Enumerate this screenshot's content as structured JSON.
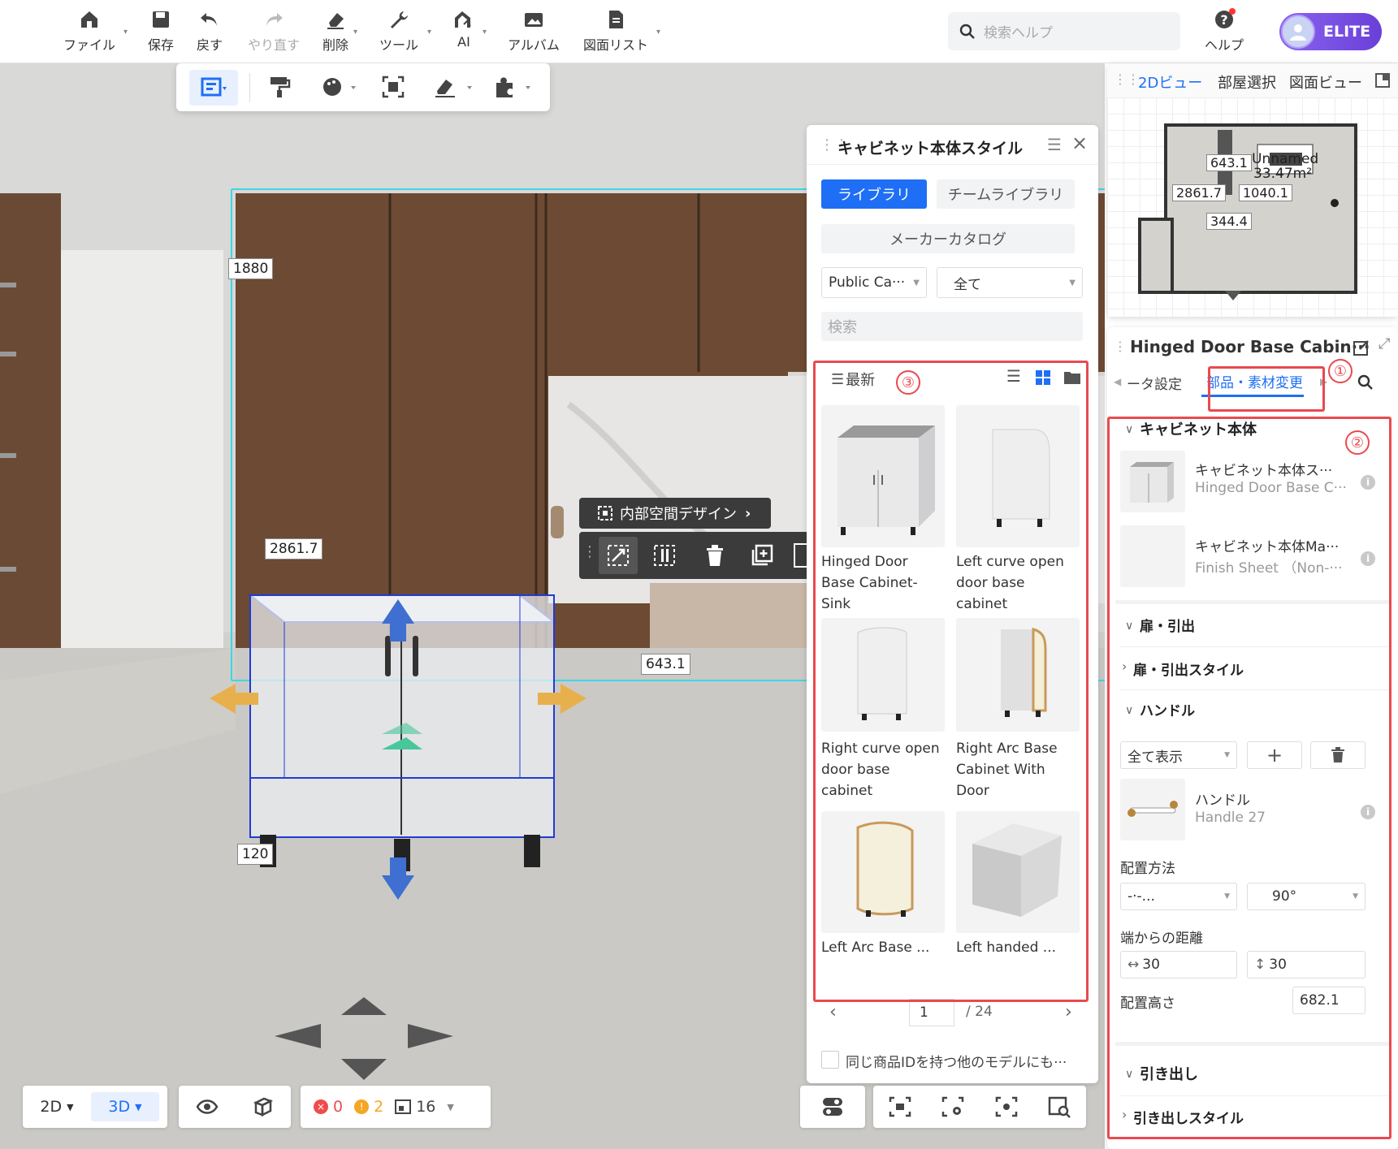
{
  "topbar": {
    "items": [
      {
        "label": "ファイル",
        "icon": "home-icon"
      },
      {
        "label": "保存",
        "icon": "save-icon"
      },
      {
        "label": "戻す",
        "icon": "undo-icon"
      },
      {
        "label": "やり直す",
        "icon": "redo-icon"
      },
      {
        "label": "削除",
        "icon": "eraser-icon"
      },
      {
        "label": "ツール",
        "icon": "wrench-icon"
      },
      {
        "label": "AI",
        "icon": "ai-icon"
      },
      {
        "label": "アルバム",
        "icon": "album-icon"
      },
      {
        "label": "図面リスト",
        "icon": "drawing-list-icon"
      }
    ],
    "search_placeholder": "検索ヘルプ",
    "help_label": "ヘルプ",
    "elite_label": "ELITE"
  },
  "viewport": {
    "dims": {
      "d1880": "1880",
      "d2861": "2861.7",
      "d643": "643.1",
      "d120": "120"
    },
    "inner_design_label": "内部空間デザイン"
  },
  "style_panel": {
    "title": "キャビネット本体スタイル",
    "tab_library": "ライブラリ",
    "tab_team": "チームライブラリ",
    "maker_catalog": "メーカーカタログ",
    "select_catalog": "Public Ca···",
    "select_all": "全て",
    "search_placeholder": "検索",
    "sort_label": "最新",
    "items": [
      {
        "name": "Hinged Door Base Cabinet-Sink"
      },
      {
        "name": "Left curve open door base cabinet"
      },
      {
        "name": "Right curve open door base cabinet"
      },
      {
        "name": "Right Arc Base Cabinet With Door"
      },
      {
        "name": "Left Arc Base ..."
      },
      {
        "name": "Left handed ..."
      }
    ],
    "page_current": "1",
    "page_total": "/ 24",
    "checkbox_label": "同じ商品IDを持つ他のモデルにも···"
  },
  "view2d": {
    "tab_2d": "2Dビュー",
    "tab_room": "部屋選択",
    "tab_drawing": "図面ビュー",
    "map_room_name": "Unnamed",
    "map_area": "33.47m²",
    "map_d1": "643.1",
    "map_d2": "2861.7",
    "map_d3": "1040.1",
    "map_d4": "344.4"
  },
  "props": {
    "title": "Hinged Door Base Cabin···",
    "tab_param": "ータ設定",
    "tab_parts": "部品・素材変更",
    "sec_body": "キャビネット本体",
    "body_items": [
      {
        "title": "キャビネット本体ス···",
        "sub": "Hinged Door Base C···"
      },
      {
        "title": "キャビネット本体Ma···",
        "sub": "Finish Sheet （Non-···"
      }
    ],
    "sec_door": "扉・引出",
    "door_style": "扉・引出スタイル",
    "sec_handle": "ハンドル",
    "handle_select": "全て表示",
    "handle_title": "ハンドル",
    "handle_sub": "Handle 27",
    "placement_label": "配置方法",
    "placement_val": "-·-...",
    "rotation_val": "90°",
    "edge_label": "端からの距離",
    "edge_h": "30",
    "edge_v": "30",
    "height_label": "配置高さ",
    "height_val": "682.1",
    "sec_drawer": "引き出し",
    "drawer_style": "引き出しスタイル"
  },
  "annotations": {
    "c1": "①",
    "c2": "②",
    "c3": "③"
  },
  "bottom": {
    "view2d": "2D",
    "view3d": "3D",
    "err_count": "0",
    "warn_count": "2",
    "item_count": "16"
  },
  "colors": {
    "accent": "#1e6ff5",
    "annotation": "#e84a4f",
    "elite": "#7b4fe0"
  }
}
